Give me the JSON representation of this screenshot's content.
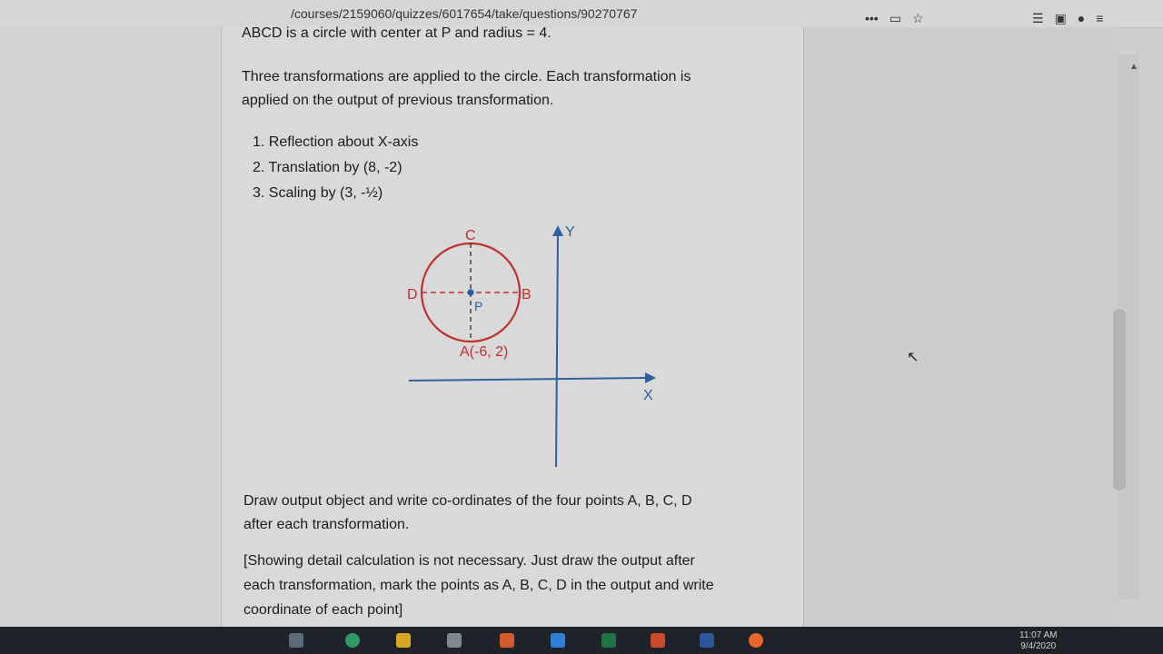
{
  "browser": {
    "url": "/courses/2159060/quizzes/6017654/take/questions/90270767",
    "overflow_menu": "•••",
    "pocket_icon": "pocket-icon",
    "bookmark_icon": "star-icon",
    "library_icon": "library-icon",
    "sidebar_icon": "sidebar-icon",
    "account_icon": "account-icon",
    "menu_icon": "hamburger-icon"
  },
  "question": {
    "intro": "ABCD is a circle with center at P and radius = 4.",
    "transform_desc_1": "Three transformations are applied to the circle. Each transformation is",
    "transform_desc_2": "applied on the output of previous transformation.",
    "steps": [
      "1. Reflection about X-axis",
      "2. Translation by (8, -2)",
      "3. Scaling by (3, -½)"
    ],
    "task_1": "Draw output object and write co-ordinates of the four points A, B, C, D",
    "task_2": "after each transformation.",
    "note_1": "[Showing detail calculation is not necessary. Just draw the output after",
    "note_2": "each transformation, mark the points as A, B, C, D in the output and write",
    "note_3": "coordinate of each point]"
  },
  "diagram": {
    "label_c": "C",
    "label_d": "D",
    "label_b": "B",
    "label_p": "P",
    "label_a": "A(-6, 2)",
    "axis_y": "Y",
    "axis_x": "X",
    "circle_color": "#c0302f",
    "axis_color": "#2f5f9e"
  },
  "taskbar": {
    "clock_time": "11:07 AM",
    "clock_date": "9/4/2020"
  }
}
